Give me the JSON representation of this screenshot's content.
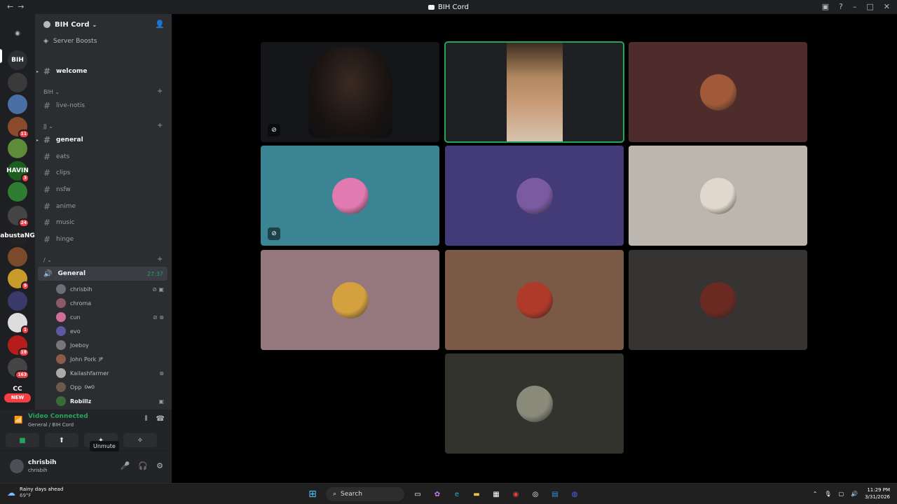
{
  "window": {
    "title": "BIH Cord",
    "back_icon": "arrow-left-icon",
    "forward_icon": "arrow-right-icon",
    "controls": [
      "inbox-icon",
      "help-icon",
      "minimize-icon",
      "maximize-icon",
      "close-icon"
    ]
  },
  "server_rail": {
    "items": [
      {
        "name": "discord-home-icon",
        "label": ""
      },
      {
        "name": "server-bih",
        "label": "BIH",
        "color": "#2c2f33",
        "selected": true
      },
      {
        "name": "server-2",
        "label": "",
        "color": "#3a3a3a"
      },
      {
        "name": "server-3",
        "label": "",
        "color": "#4a6fa5"
      },
      {
        "name": "server-4",
        "label": "",
        "color": "#8b4a2b",
        "badge": "11"
      },
      {
        "name": "server-5",
        "label": "",
        "color": "#5d8b3a"
      },
      {
        "name": "server-6",
        "label": "HAVIN",
        "color": "#1b5e20",
        "badge": "3"
      },
      {
        "name": "server-7",
        "label": "",
        "color": "#2e7d32"
      },
      {
        "name": "server-8",
        "label": "",
        "color": "#444",
        "badge": "24"
      },
      {
        "name": "server-9",
        "label": "abustaNG",
        "color": "#222"
      },
      {
        "name": "server-10",
        "label": "",
        "color": "#7a4a2a"
      },
      {
        "name": "server-11",
        "label": "",
        "color": "#c89b2a",
        "badge": "9"
      },
      {
        "name": "server-12",
        "label": "",
        "color": "#3a3a6a"
      },
      {
        "name": "server-13",
        "label": "",
        "color": "#ddd",
        "badge": "1"
      },
      {
        "name": "server-14",
        "label": "",
        "color": "#b71c1c",
        "badge": "18"
      },
      {
        "name": "server-15",
        "label": "",
        "color": "#444",
        "badge": "163"
      },
      {
        "name": "server-16",
        "label": "CC",
        "color": "#1e1f22"
      }
    ],
    "new_badge": "NEW"
  },
  "guild": {
    "name": "BIH Cord",
    "server_boosts": "Server Boosts",
    "invite_icon": "add-member-icon"
  },
  "channels": {
    "welcome": "welcome",
    "category_bih": "BIH",
    "live_notis": "live-notis",
    "category_jj": "JJ",
    "general": "general",
    "eats": "eats",
    "clips": "clips",
    "nsfw": "nsfw",
    "anime": "anime",
    "music": "music",
    "hinge": "hinge",
    "category_slash": "/",
    "voice_general": "General",
    "voice_timer": "27:37"
  },
  "voice_members": [
    {
      "name": "chrisbih",
      "color": "#6d6f78",
      "icons": "⊘ ▣",
      "tag": ""
    },
    {
      "name": "chroma",
      "color": "#8a5a6a",
      "icons": "",
      "tag": ""
    },
    {
      "name": "cun",
      "color": "#d06e9a",
      "icons": "⊘ ⊗",
      "tag": ""
    },
    {
      "name": "evo",
      "color": "#5a5aa0",
      "icons": "",
      "tag": ""
    },
    {
      "name": "Joeboy",
      "color": "#777",
      "icons": "",
      "tag": ""
    },
    {
      "name": "John Pork",
      "color": "#8a5a4a",
      "icons": "",
      "tag": "JP"
    },
    {
      "name": "Kailashfarmer",
      "color": "#aaa",
      "icons": "⊗",
      "tag": ""
    },
    {
      "name": "Opp",
      "color": "#6a5a4a",
      "icons": "",
      "tag": "OwO"
    },
    {
      "name": "Robillz",
      "color": "#3a6a3a",
      "icons": "▣",
      "tag": "",
      "strong": true
    }
  ],
  "voice_panel": {
    "status": "Video Connected",
    "subtitle": "General / BIH Cord",
    "tooltip": "Unmute"
  },
  "user": {
    "display_name": "chrisbih",
    "username": "chrisbih"
  },
  "tiles": [
    {
      "name": "tile-video-1",
      "bg": "#15161a",
      "type": "video",
      "mic_off": true
    },
    {
      "name": "tile-video-2",
      "bg": "#1f2023",
      "type": "video",
      "speaking": true
    },
    {
      "name": "tile-avatar-3",
      "bg": "#4e2c2c",
      "avatar": "#a05a3a"
    },
    {
      "name": "tile-avatar-4",
      "bg": "#3a8494",
      "avatar": "#e07ab0",
      "mic_off": true
    },
    {
      "name": "tile-avatar-5",
      "bg": "#433a78",
      "avatar": "#7a5aa0"
    },
    {
      "name": "tile-avatar-6",
      "bg": "#bbb6ae",
      "avatar": "#e0d8cc"
    },
    {
      "name": "tile-avatar-7",
      "bg": "#94787e",
      "avatar": "#d4a040"
    },
    {
      "name": "tile-avatar-8",
      "bg": "#7a5a46",
      "avatar": "#b03a2a"
    },
    {
      "name": "tile-avatar-9",
      "bg": "#363432",
      "avatar": "#6a2a22"
    },
    {
      "name": "tile-avatar-10",
      "bg": "#33332e",
      "avatar": "#8a8a7a"
    }
  ],
  "taskbar": {
    "weather_title": "Rainy days ahead",
    "weather_temp": "69°F",
    "search_label": "Search",
    "time": "11:29 PM",
    "date": "3/31/2026"
  }
}
